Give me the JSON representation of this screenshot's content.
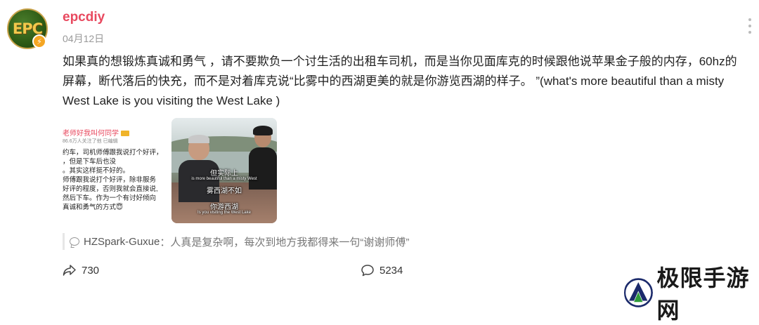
{
  "user": {
    "avatar_text": "EPC",
    "badge_symbol": "⚡",
    "name": "epcdiy",
    "date": "04月12日"
  },
  "post": {
    "text": "如果真的想锻炼真诚和勇气 ，请不要欺负一个讨生活的出租车司机，而是当你见面库克的时候跟他说苹果金子般的内存，60hz的屏幕，断代落后的快充，而不是对着库克说“比雾中的西湖更美的就是你游览西湖的样子。 ”(what's more beautiful than a misty West Lake is you visiting the West Lake )"
  },
  "image1": {
    "header": "老师好我叫何同学",
    "sub": "86.6万人关注了他 已编辑",
    "lines": [
      "约车，司机师傅跟我说打个好评，",
      "，但是下车后也没",
      "。其实这样挺不好的。",
      "师傅跟我说打个好评，除非服务",
      "好评的程度，否则我就会直接说,",
      "然后下车。作为一个有讨好倾向",
      "真诚和勇气的方式😇"
    ]
  },
  "image2": {
    "captions": [
      "但实际上",
      "is more beautiful than a misty West",
      "雾西湖不如",
      "",
      "你游西湖",
      "Is you visiting the West Lake"
    ]
  },
  "comment": {
    "user": "HZSpark-Guxue",
    "separator": "：",
    "text": "人真是复杂啊，每次到地方我都得来一句“谢谢师傅”"
  },
  "actions": {
    "share_count": "730",
    "comment_count": "5234"
  },
  "watermark": {
    "text": "极限手游网"
  },
  "colors": {
    "username": "#e8495f",
    "watermark_green": "#2e9b3a",
    "watermark_navy": "#1b2a6b"
  }
}
